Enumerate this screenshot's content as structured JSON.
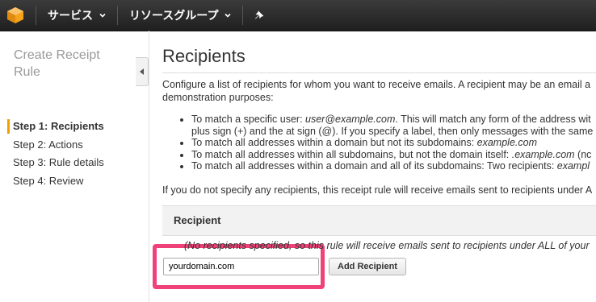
{
  "nav": {
    "services_label": "サービス",
    "resource_groups_label": "リソースグループ"
  },
  "sidebar": {
    "title": "Create Receipt Rule",
    "steps": [
      {
        "label": "Step 1: Recipients",
        "active": true
      },
      {
        "label": "Step 2: Actions",
        "active": false
      },
      {
        "label": "Step 3: Rule details",
        "active": false
      },
      {
        "label": "Step 4: Review",
        "active": false
      }
    ]
  },
  "main": {
    "title": "Recipients",
    "intro_line1": "Configure a list of recipients for whom you want to receive emails. A recipient may be an email a",
    "intro_line2": "demonstration purposes:",
    "bullets": [
      {
        "prefix": "To match a specific user: ",
        "example": "user@example.com",
        "suffix": ". This will match any form of the address wit"
      },
      {
        "prefix": "plus sign (+) and the at sign (@). If you specify a label, then only messages with the same",
        "example": "",
        "suffix": ""
      },
      {
        "prefix": "To match all addresses within a domain but not its subdomains: ",
        "example": "example.com",
        "suffix": ""
      },
      {
        "prefix": "To match all addresses within all subdomains, but not the domain itself: ",
        "example": ".example.com",
        "suffix": " (nc"
      },
      {
        "prefix": "To match all addresses within a domain and all of its subdomains: Two recipients: ",
        "example": "exampl",
        "suffix": ""
      }
    ],
    "note": "If you do not specify any recipients, this receipt rule will receive emails sent to recipients under A",
    "table_header": "Recipient",
    "empty_message": "(No recipients specified, so this rule will receive emails sent to recipients under ALL of your",
    "input_value": "yourdomain.com",
    "add_button_label": "Add Recipient"
  },
  "colors": {
    "topbar": "#232f3e",
    "active_step_accent": "#f0a000",
    "highlight": "#f0427a"
  }
}
